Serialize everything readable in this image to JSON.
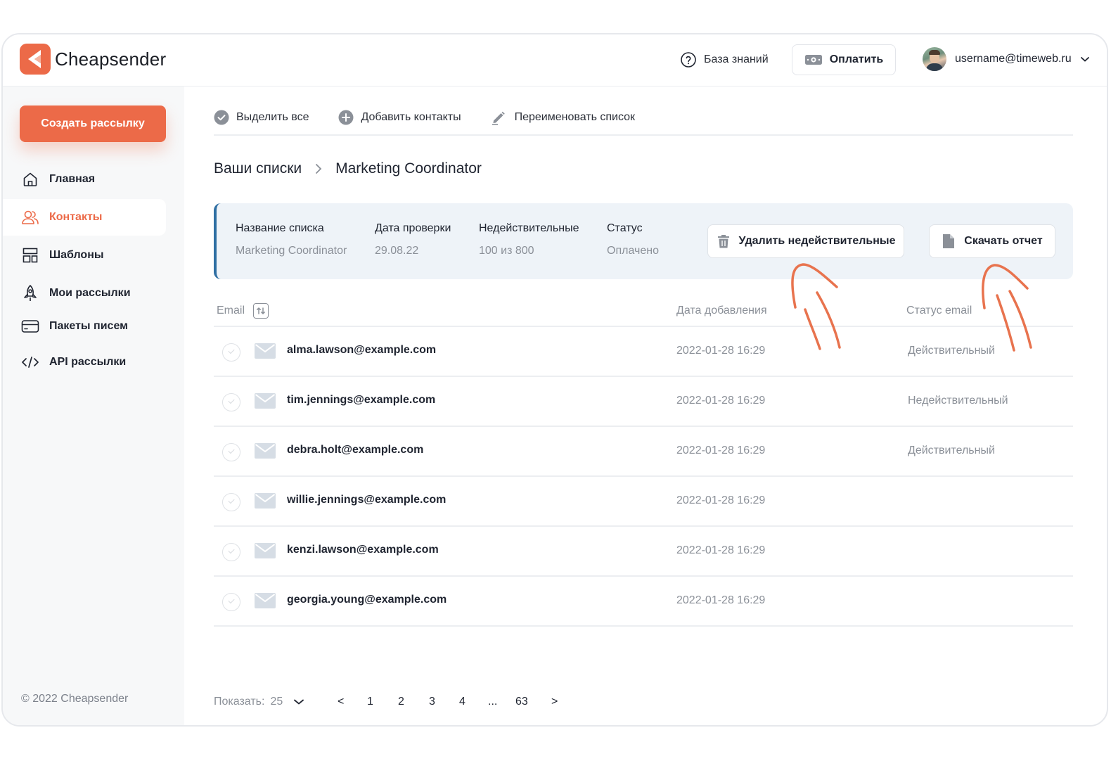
{
  "brand": {
    "name": "Cheapsender",
    "accent": "#ec6a48"
  },
  "header": {
    "knowledge_base": "База знаний",
    "pay_label": "Оплатить",
    "user_email": "username@timeweb.ru"
  },
  "sidebar": {
    "create_label": "Создать рассылку",
    "items": [
      {
        "label": "Главная",
        "icon": "home-icon"
      },
      {
        "label": "Контакты",
        "icon": "contacts-icon",
        "active": true
      },
      {
        "label": "Шаблоны",
        "icon": "templates-icon"
      },
      {
        "label": "Мои рассылки",
        "icon": "rocket-icon"
      },
      {
        "label": "Пакеты писем",
        "icon": "card-icon"
      },
      {
        "label": "API рассылки",
        "icon": "code-icon"
      }
    ],
    "copyright": "© 2022 Cheapsender"
  },
  "toolbar": {
    "select_all": "Выделить все",
    "add_contacts": "Добавить контакты",
    "rename_list": "Переименовать список"
  },
  "breadcrumb": {
    "root": "Ваши списки",
    "current": "Marketing Coordinator"
  },
  "info_card": {
    "name_label": "Название списка",
    "name_value": "Marketing Coordinator",
    "date_label": "Дата проверки",
    "date_value": "29.08.22",
    "invalid_label": "Недействительные",
    "invalid_value": "100 из 800",
    "status_label": "Статус",
    "status_value": "Оплачено",
    "delete_invalid": "Удалить недействительные",
    "download_report": "Скачать отчет"
  },
  "table": {
    "columns": [
      "Email",
      "Дата добавления",
      "Статус email"
    ],
    "rows": [
      {
        "email": "alma.lawson@example.com",
        "date": "2022-01-28  16:29",
        "status": "Действительный"
      },
      {
        "email": "tim.jennings@example.com",
        "date": "2022-01-28  16:29",
        "status": "Недействительный"
      },
      {
        "email": "debra.holt@example.com",
        "date": "2022-01-28  16:29",
        "status": "Действительный"
      },
      {
        "email": "willie.jennings@example.com",
        "date": "2022-01-28  16:29",
        "status": ""
      },
      {
        "email": "kenzi.lawson@example.com",
        "date": "2022-01-28  16:29",
        "status": ""
      },
      {
        "email": "georgia.young@example.com",
        "date": "2022-01-28  16:29",
        "status": ""
      }
    ]
  },
  "pagination": {
    "show_label": "Показать:",
    "page_size": "25",
    "pages": [
      "1",
      "2",
      "3",
      "4",
      "...",
      "63"
    ],
    "prev": "<",
    "next": ">"
  }
}
